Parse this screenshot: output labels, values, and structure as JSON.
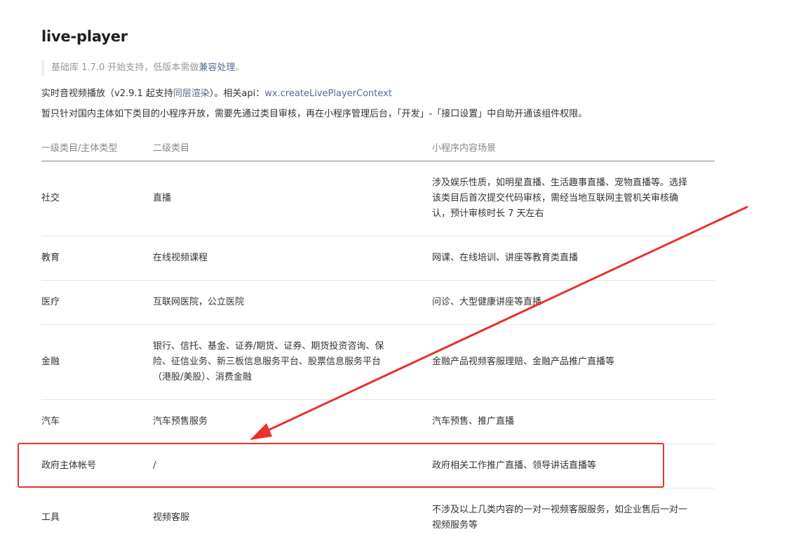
{
  "doc": {
    "title": "live-player",
    "tip": {
      "text": "基础库 1.7.0 开始支持，低版本需做",
      "link": "兼容处理",
      "suffix": "。"
    },
    "desc1": {
      "prefix": "实时音视频播放（v2.9.1 起支持",
      "link1": "同层渲染",
      "middle": "）。相关api：",
      "link2": "wx.createLivePlayerContext"
    },
    "desc2": "暂只针对国内主体如下类目的小程序开放，需要先通过类目审核，再在小程序管理后台，「开发」-「接口设置」中自助开通该组件权限。"
  },
  "table": {
    "headers": [
      "一级类目/主体类型",
      "二级类目",
      "小程序内容场景"
    ],
    "rows": [
      {
        "c1": "社交",
        "c2": "直播",
        "c3": [
          "涉及娱乐性质，如明星直播、生活趣事直播、宠物直播等。选择",
          "该类目后首次提交代码审核，需经当地互联网主管机关审核确",
          "认，预计审核时长 7 天左右"
        ]
      },
      {
        "c1": "教育",
        "c2": "在线视频课程",
        "c3": [
          "网课、在线培训、讲座等教育类直播"
        ]
      },
      {
        "c1": "医疗",
        "c2": "互联网医院，公立医院",
        "c3": [
          "问诊、大型健康讲座等直播"
        ]
      },
      {
        "c1": "金融",
        "c2": [
          "银行、信托、基金、证券/期货、证券、期货投资咨询、保",
          "险、征信业务、新三板信息服务平台、股票信息服务平台",
          "（港股/美股）、消费金融"
        ],
        "c3": [
          "金融产品视频客服理赔、金融产品推广直播等"
        ]
      },
      {
        "c1": "汽车",
        "c2": "汽车预售服务",
        "c3": [
          "汽车预售、推广直播"
        ]
      },
      {
        "c1": "政府主体帐号",
        "c2": "/",
        "c3": [
          "政府相关工作推广直播、领导讲话直播等"
        ]
      },
      {
        "c1": "工具",
        "c2": "视频客服",
        "c3": [
          "不涉及以上几类内容的一对一视频客服服务，如企业售后一对一",
          "视频服务等"
        ]
      }
    ]
  },
  "annotation": {
    "color": "#e8322c",
    "highlight": "box around 政府主体帐号 row",
    "arrow_icon": "red-arrow-icon"
  }
}
